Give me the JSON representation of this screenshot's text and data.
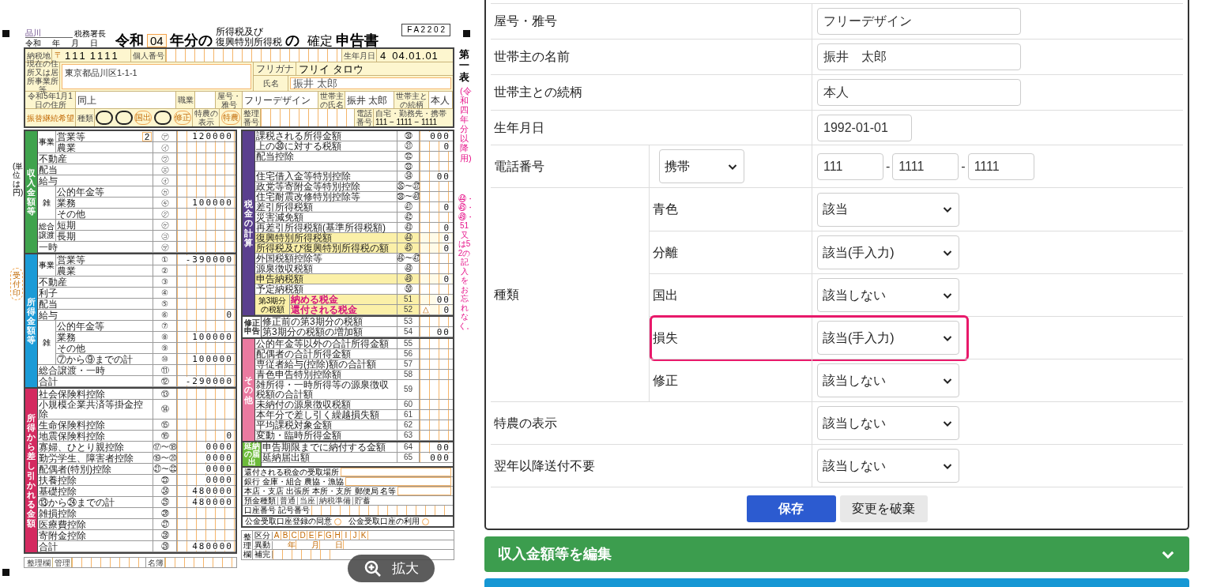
{
  "tax_form": {
    "tax_office": "品川",
    "tax_office_suffix": "税務署長",
    "date_labels": [
      "令和",
      "年",
      "月",
      "日"
    ],
    "title": {
      "era": "令和",
      "year": "04",
      "year_suffix": "年分の",
      "tax_name_1": "所得税及び",
      "tax_name_2": "復興特別所得税",
      "particle": "の",
      "type": "確定",
      "suffix": "申告書"
    },
    "form_code": "F A 2 2 0 2",
    "sheet_label": "第一表",
    "period_note": "(令和四年分以降用)",
    "unit_note": "(単位は円)",
    "stamp": "受付印",
    "reminder": "㊹・㊺・㊾・51又は52の記入をお忘れなく。",
    "info": {
      "postal_label": "納税地",
      "postal_mark": "〒",
      "postal_code_1": "111",
      "postal_code_2": "1111",
      "my_number_label": "個人番号",
      "birth_label": "生年月日",
      "birth_era": "4",
      "birth_date": "04.01.01",
      "address_label": "現在の住所又は居所事業所等",
      "address": "東京都品川区1-1-1",
      "furigana_label": "フリガナ",
      "furigana": "フリイ タロウ",
      "name_label": "氏名",
      "name": "振井 太郎",
      "jan1_label": "令和5年1月1日の住所",
      "jan1_address": "同上",
      "job_label": "職業",
      "trade_label": "屋号・雅号",
      "trade_name": "フリーデザイン",
      "head_label": "世帯主の氏名",
      "head_name": "振井 太郎",
      "relation_label": "世帯主との続柄",
      "relation": "本人",
      "transfer_label": "振替継続希望",
      "kinds_label": "種類",
      "kinds": [
        {
          "marked": true
        },
        {
          "marked": true
        },
        {
          "label": "国出",
          "marked": false
        },
        {
          "marked": true
        },
        {
          "label": "修正",
          "marked": false
        }
      ],
      "tokuno_label": "特農の表示",
      "tokuno": "特農",
      "seiri_label": "整理番号",
      "phone_label": "電話番号",
      "phone_kind": "自宅・勤務先・携帯",
      "phone": "111 − 1111 − 1111"
    },
    "left_sections": [
      {
        "title": "収入金額等",
        "color": "#3fa34d",
        "rows": [
          {
            "kind": "group",
            "label": "事業",
            "children": [
              {
                "label": "営業等",
                "category": "2",
                "num": "㋐",
                "value": "120000"
              },
              {
                "label": "農業",
                "num": "㋑"
              }
            ]
          },
          {
            "label": "不動産",
            "num": "㋒"
          },
          {
            "label": "配当",
            "num": "㋓"
          },
          {
            "label": "給与",
            "num": "㋔"
          },
          {
            "kind": "group",
            "label": "雑",
            "children": [
              {
                "label": "公的年金等",
                "num": "㋕"
              },
              {
                "label": "業務",
                "num": "㋖",
                "value": "100000"
              },
              {
                "label": "その他",
                "num": "㋗"
              }
            ]
          },
          {
            "kind": "group",
            "label": "総合譲渡",
            "children": [
              {
                "label": "短期",
                "num": "㋘"
              },
              {
                "label": "長期",
                "num": "㋙"
              }
            ]
          },
          {
            "label": "一時",
            "num": "㋚"
          }
        ]
      },
      {
        "title": "所得金額等",
        "color": "#1b9bd7",
        "rows": [
          {
            "kind": "group",
            "label": "事業",
            "children": [
              {
                "label": "営業等",
                "num": "①",
                "value": "-390000"
              },
              {
                "label": "農業",
                "num": "②"
              }
            ]
          },
          {
            "label": "不動産",
            "num": "③"
          },
          {
            "label": "利子",
            "num": "④"
          },
          {
            "label": "配当",
            "num": "⑤"
          },
          {
            "label": "給与",
            "num": "⑥",
            "value": "0"
          },
          {
            "kind": "group",
            "label": "雑",
            "children": [
              {
                "label": "公的年金等",
                "num": "⑦"
              },
              {
                "label": "業務",
                "num": "⑧",
                "value": "100000"
              },
              {
                "label": "その他",
                "num": "⑨"
              },
              {
                "label": "⑦から⑨までの計",
                "num": "⑩",
                "value": "100000"
              }
            ]
          },
          {
            "label": "総合譲渡・一時",
            "num": "⑪"
          },
          {
            "label": "合計",
            "num": "⑫",
            "value": "-290000"
          }
        ]
      },
      {
        "title": "所得から差し引かれる金額",
        "color": "#d42a60",
        "rows": [
          {
            "label": "社会保険料控除",
            "num": "⑬"
          },
          {
            "label": "小規模企業共済等掛金控除",
            "num": "⑭"
          },
          {
            "label": "生命保険料控除",
            "num": "⑮"
          },
          {
            "label": "地震保険料控除",
            "num": "⑯",
            "value": "0"
          },
          {
            "label": "寡婦、ひとり親控除",
            "num": "⑰〜⑱",
            "value": "0000"
          },
          {
            "label": "勤労学生、障害者控除",
            "num": "⑲〜⑳",
            "value": "0000"
          },
          {
            "label": "配偶者(特別)控除",
            "num": "㉑〜㉒",
            "value": "0000"
          },
          {
            "label": "扶養控除",
            "num": "㉓",
            "value": "0000"
          },
          {
            "label": "基礎控除",
            "num": "㉔",
            "value": "480000"
          },
          {
            "label": "⑬から㉔までの計",
            "num": "㉕",
            "value": "480000"
          },
          {
            "label": "雑損控除",
            "num": "㉖"
          },
          {
            "label": "医療費控除",
            "num": "㉗"
          },
          {
            "label": "寄附金控除",
            "num": "㉘"
          },
          {
            "label": "合計",
            "num": "㉙",
            "value": "480000"
          }
        ]
      }
    ],
    "left_footer": {
      "label": "整理欄",
      "sub_label": "管理",
      "list_label": "名簿"
    },
    "right_sections": [
      {
        "title": "税金の計算",
        "color": "#5a3f8e",
        "rows": [
          {
            "label": "課税される所得金額",
            "num": "㉚",
            "value": "000"
          },
          {
            "label": "上の㉚に対する税額",
            "num": "㉛",
            "value": "0"
          },
          {
            "label": "配当控除",
            "num": "㉜"
          },
          {
            "num": "㉝"
          },
          {
            "label": "住宅借入金等特別控除",
            "num": "㉞",
            "value": "00"
          },
          {
            "label": "政党等寄附金等特別控除",
            "num": "㉟〜㊲"
          },
          {
            "label": "住宅耐震改修特別控除等",
            "num": "㊳〜㊵"
          },
          {
            "label": "差引所得税額",
            "num": "㊶",
            "value": "0"
          },
          {
            "label": "災害減免額",
            "num": "㊷"
          },
          {
            "label": "再差引所得税額(基準所得税額)",
            "num": "㊸",
            "value": "0"
          },
          {
            "label": "復興特別所得税額",
            "num": "㊹",
            "value": "0",
            "highlight": true
          },
          {
            "label": "所得税及び復興特別所得税の額",
            "num": "㊺",
            "value": "0",
            "highlight": true
          },
          {
            "label": "外国税額控除等",
            "num": "㊻〜㊼"
          },
          {
            "label": "源泉徴収税額",
            "num": "㊽"
          },
          {
            "label": "申告納税額",
            "num": "㊾",
            "value": "0",
            "highlight": true
          },
          {
            "label": "予定納税額",
            "num": "㊿"
          },
          {
            "kind": "wide_group",
            "label": "第3期分の税額",
            "highlight": true,
            "children": [
              {
                "label": "納める税金",
                "num": "51",
                "value": "00"
              },
              {
                "label": "還付される税金",
                "num": "52",
                "prefix": "△",
                "value": "0"
              }
            ]
          }
        ]
      },
      {
        "title": "修正申告",
        "rows": [
          {
            "label": "修正前の第3期分の税額",
            "num": "53"
          },
          {
            "label": "第3期分の税額の増加額",
            "num": "54",
            "value": "00"
          }
        ]
      },
      {
        "title": "その他",
        "color": "#ea7aa0",
        "rows": [
          {
            "label": "公的年金等以外の合計所得金額",
            "num": "55"
          },
          {
            "label": "配偶者の合計所得金額",
            "num": "56"
          },
          {
            "label": "専従者給与(控除)額の合計額",
            "num": "57"
          },
          {
            "label": "青色申告特別控除額",
            "num": "58"
          },
          {
            "label": "雑所得・一時所得等の源泉徴収税額の合計額",
            "num": "59"
          },
          {
            "label": "未納付の源泉徴収税額",
            "num": "60"
          },
          {
            "label": "本年分で差し引く繰越損失額",
            "num": "61"
          },
          {
            "label": "平均課税対象金額",
            "num": "62"
          },
          {
            "label": "変動・臨時所得金額",
            "num": "63"
          }
        ]
      },
      {
        "title": "延納の届出",
        "color": "#6dbb3b",
        "rows": [
          {
            "label": "申告期限までに納付する金額",
            "num": "64",
            "value": "00"
          },
          {
            "label": "延納届出額",
            "num": "65",
            "value": "000"
          }
        ]
      }
    ],
    "refund": {
      "label": "還付される税金の受取場所",
      "bank_label": "銀行 金庫・組合 農協・漁協",
      "branch_label": "本店・支店 出張所 本所・支所",
      "post_label": "郵便局 名等",
      "deposit_label": "預金種類",
      "deposit_kinds": [
        "普通",
        "当座",
        "納税準備",
        "貯蓄"
      ],
      "account_label": "口座番号 記号番号"
    },
    "kokin": [
      "公金受取口座登録の同意",
      "公金受取口座の利用"
    ],
    "seiri": {
      "label": "整理欄",
      "category_label": "区分",
      "letters": [
        "A",
        "B",
        "C",
        "D",
        "E",
        "F",
        "G",
        "H",
        "I",
        "J",
        "K"
      ],
      "change_label": "異動",
      "date_units": [
        "年",
        "月",
        "日"
      ],
      "complement_label": "補完"
    }
  },
  "zoom_button": {
    "label": "拡大"
  },
  "detail_form": {
    "rows": [
      {
        "kind": "text",
        "label": "屋号・雅号",
        "value": "フリーデザイン"
      },
      {
        "kind": "text",
        "label": "世帯主の名前",
        "value": "振井　太郎"
      },
      {
        "kind": "text",
        "label": "世帯主との続柄",
        "value": "本人"
      },
      {
        "kind": "date",
        "label": "生年月日",
        "value": "1992-01-01"
      },
      {
        "kind": "phone",
        "label": "電話番号",
        "select": "携帯",
        "separator": "-",
        "parts": [
          "111",
          "1111",
          "1111"
        ]
      },
      {
        "kind": "group",
        "label": "種類",
        "children": [
          {
            "label": "青色",
            "value": "該当",
            "highlighted": false
          },
          {
            "label": "分離",
            "value": "該当(手入力)",
            "highlighted": false
          },
          {
            "label": "国出",
            "value": "該当しない",
            "highlighted": false
          },
          {
            "label": "損失",
            "value": "該当(手入力)",
            "highlighted": true
          },
          {
            "label": "修正",
            "value": "該当しない",
            "highlighted": false
          }
        ]
      },
      {
        "kind": "select",
        "label": "特農の表示",
        "value": "該当しない"
      },
      {
        "kind": "select",
        "label": "翌年以降送付不要",
        "value": "該当しない"
      }
    ],
    "buttons": [
      {
        "kind": "primary",
        "label": "保存"
      },
      {
        "kind": "secondary",
        "label": "変更を破棄"
      }
    ]
  },
  "accordions": [
    {
      "label": "収入金額等を編集",
      "color": "#3c9d4e"
    },
    {
      "color": "#1697d4"
    }
  ]
}
